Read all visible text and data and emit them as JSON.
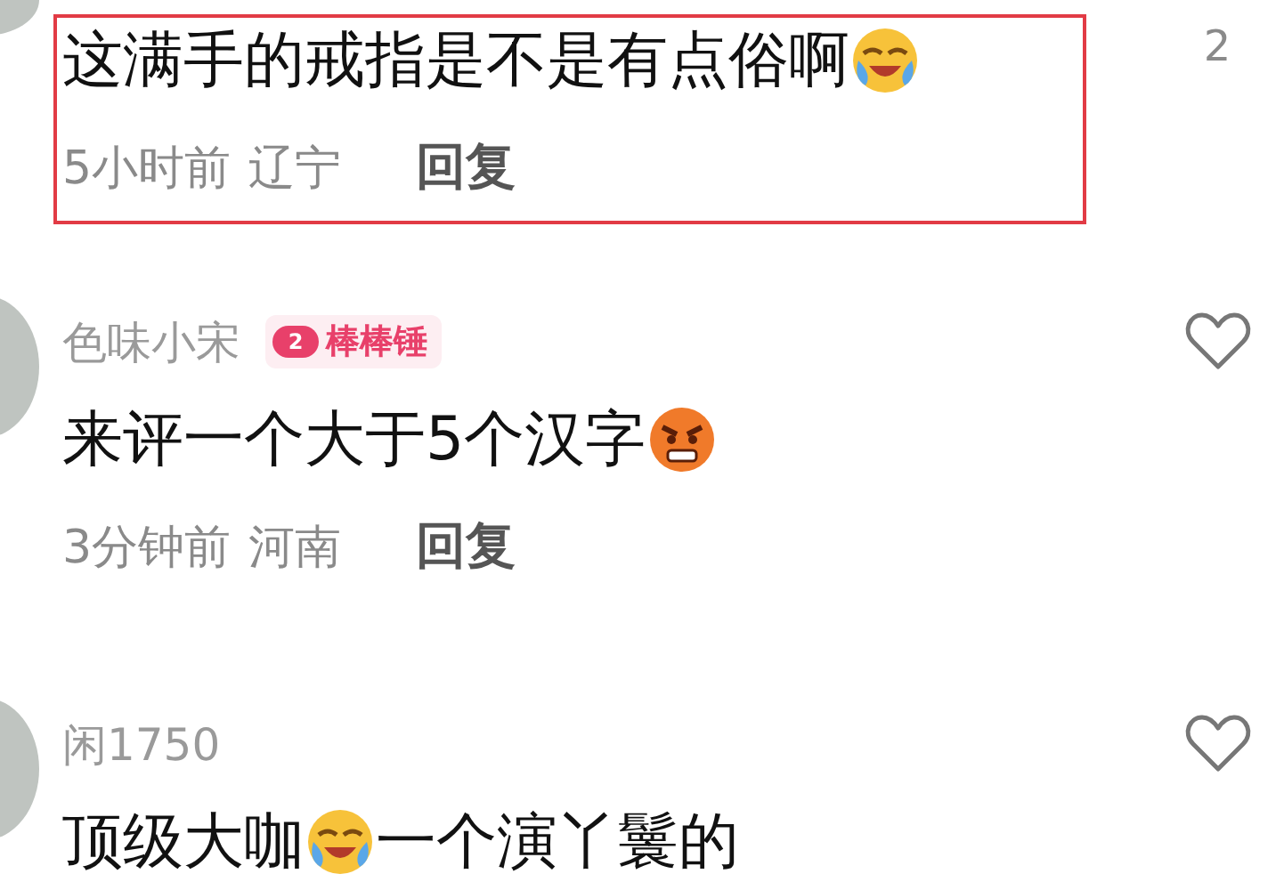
{
  "comments": [
    {
      "parts": [
        {
          "kind": "text",
          "text": "这满手的戒指是不是有点俗啊"
        },
        {
          "kind": "cry"
        }
      ],
      "time": "5小时前",
      "location": "辽宁",
      "reply": "回复",
      "like_count": "2",
      "highlighted": true
    },
    {
      "username": "色味小宋",
      "badge": {
        "level": "2",
        "label": "棒棒锤"
      },
      "parts": [
        {
          "kind": "text",
          "text": "来评一个大于5个汉字"
        },
        {
          "kind": "angry"
        }
      ],
      "time": "3分钟前",
      "location": "河南",
      "reply": "回复",
      "liked": false,
      "highlighted": false
    },
    {
      "username": "闲1750",
      "parts": [
        {
          "kind": "text",
          "text": "顶级大咖"
        },
        {
          "kind": "cry"
        },
        {
          "kind": "text",
          "text": "一个演丫鬟的"
        }
      ],
      "liked": false,
      "highlighted": false
    }
  ]
}
